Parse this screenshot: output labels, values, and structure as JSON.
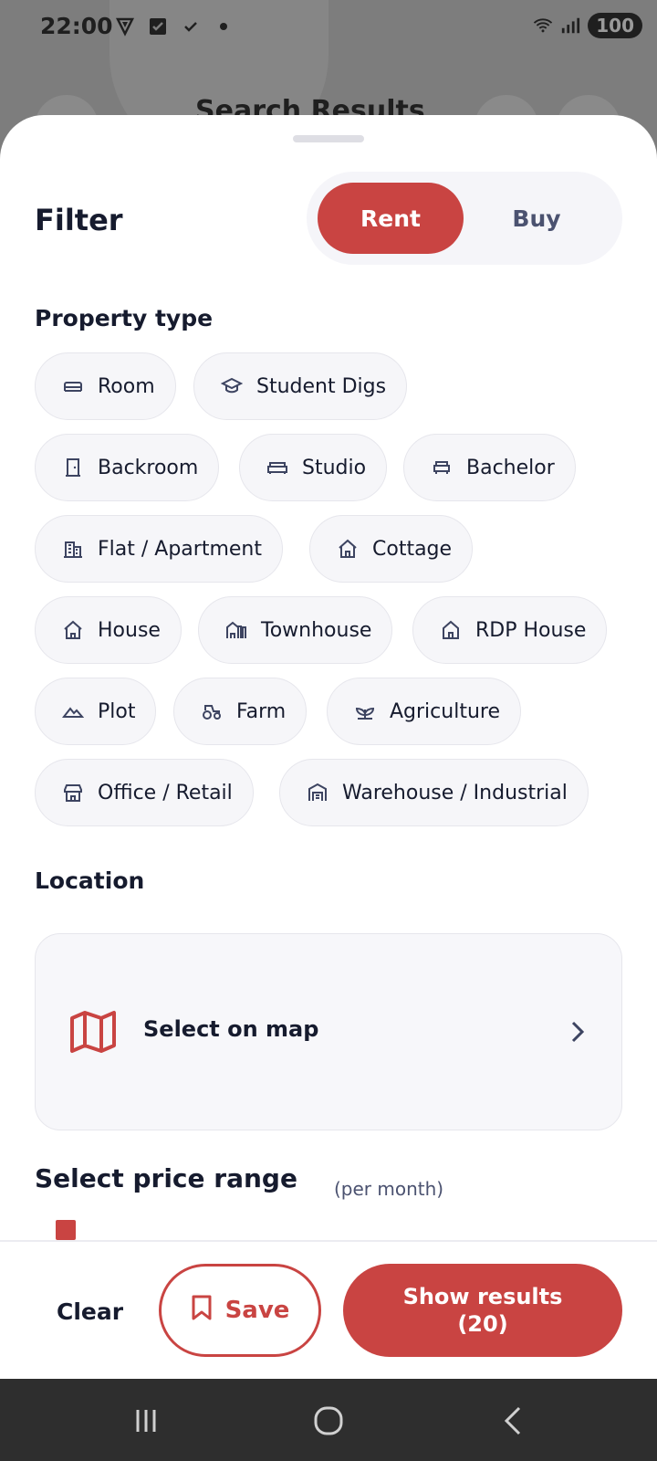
{
  "status_bar": {
    "time": "22:00",
    "battery": "100"
  },
  "background": {
    "title": "Search Results"
  },
  "filter": {
    "title": "Filter",
    "mode_options": [
      "Rent",
      "Buy"
    ],
    "selected_mode": "Rent"
  },
  "property_type": {
    "title": "Property type",
    "chips": [
      {
        "label": "Room",
        "icon": "bed-icon"
      },
      {
        "label": "Student Digs",
        "icon": "graduation-cap-icon"
      },
      {
        "label": "Backroom",
        "icon": "door-icon"
      },
      {
        "label": "Studio",
        "icon": "sofa-icon"
      },
      {
        "label": "Bachelor",
        "icon": "armchair-icon"
      },
      {
        "label": "Flat / Apartment",
        "icon": "building-icon"
      },
      {
        "label": "Cottage",
        "icon": "cottage-icon"
      },
      {
        "label": "House",
        "icon": "house-icon"
      },
      {
        "label": "Townhouse",
        "icon": "townhouse-icon"
      },
      {
        "label": "RDP House",
        "icon": "home-outline-icon"
      },
      {
        "label": "Plot",
        "icon": "mountain-icon"
      },
      {
        "label": "Farm",
        "icon": "tractor-icon"
      },
      {
        "label": "Agriculture",
        "icon": "plant-icon"
      },
      {
        "label": "Office / Retail",
        "icon": "store-icon"
      },
      {
        "label": "Warehouse / Industrial",
        "icon": "warehouse-icon"
      }
    ]
  },
  "location": {
    "title": "Location",
    "select_label": "Select on map",
    "icon": "map-icon"
  },
  "price": {
    "title": "Select price range",
    "subtitle": "(per month)"
  },
  "actions": {
    "clear_label": "Clear",
    "save_label": "Save",
    "show_results_label": "Show results",
    "show_results_count": "(20)"
  },
  "colors": {
    "accent": "#c94442",
    "text": "#161b2e",
    "chip_bg": "#f6f6f9"
  }
}
